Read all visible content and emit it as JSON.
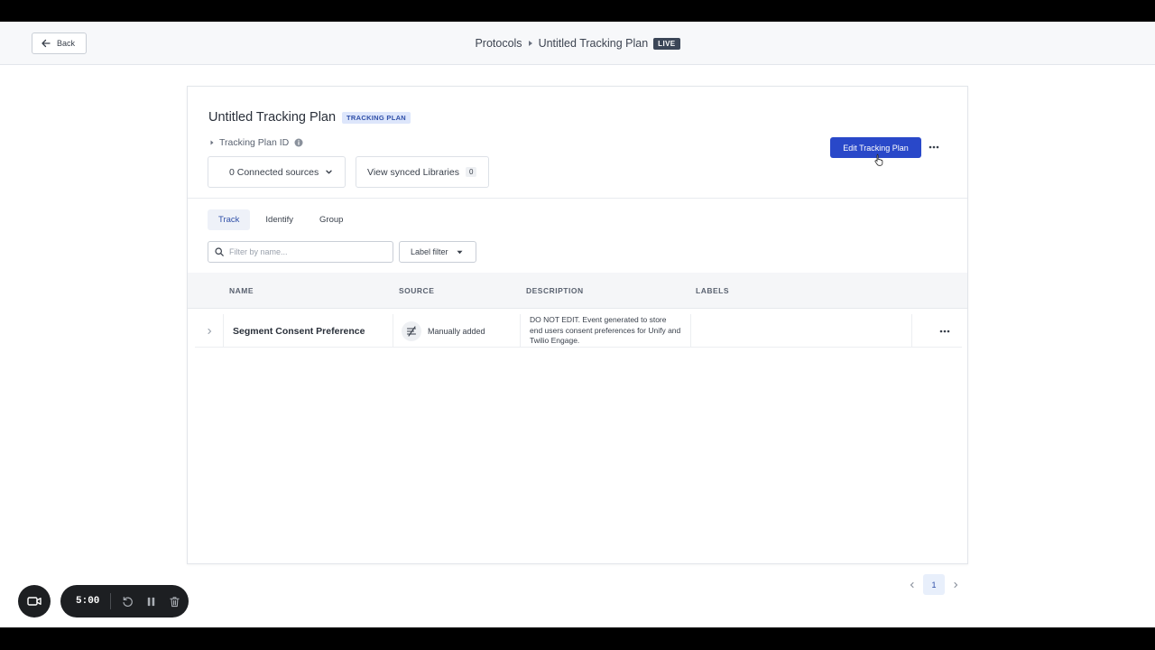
{
  "topbar": {
    "back_label": "Back",
    "breadcrumb_root": "Protocols",
    "breadcrumb_current": "Untitled Tracking Plan",
    "status_badge": "LIVE"
  },
  "plan": {
    "title": "Untitled Tracking Plan",
    "tag": "TRACKING PLAN",
    "id_label": "Tracking Plan ID",
    "connected_sources": "0 Connected sources",
    "libraries_label": "View synced Libraries",
    "libraries_count": "0",
    "edit_label": "Edit Tracking Plan"
  },
  "tabs": [
    {
      "label": "Track",
      "active": true
    },
    {
      "label": "Identify",
      "active": false
    },
    {
      "label": "Group",
      "active": false
    }
  ],
  "filters": {
    "search_placeholder": "Filter by name...",
    "label_filter": "Label filter"
  },
  "table": {
    "columns": [
      "NAME",
      "SOURCE",
      "DESCRIPTION",
      "LABELS"
    ],
    "rows": [
      {
        "name": "Segment Consent Preference",
        "source": "Manually added",
        "description": "DO NOT EDIT. Event generated to store end users consent preferences for Unify and Twilio Engage.",
        "labels": ""
      }
    ]
  },
  "pagination": {
    "current_page": "1"
  },
  "recorder": {
    "time": "5:00"
  },
  "colors": {
    "primary": "#2948c9",
    "tag_bg": "#dde6fb",
    "badge_bg": "#3b4657"
  }
}
